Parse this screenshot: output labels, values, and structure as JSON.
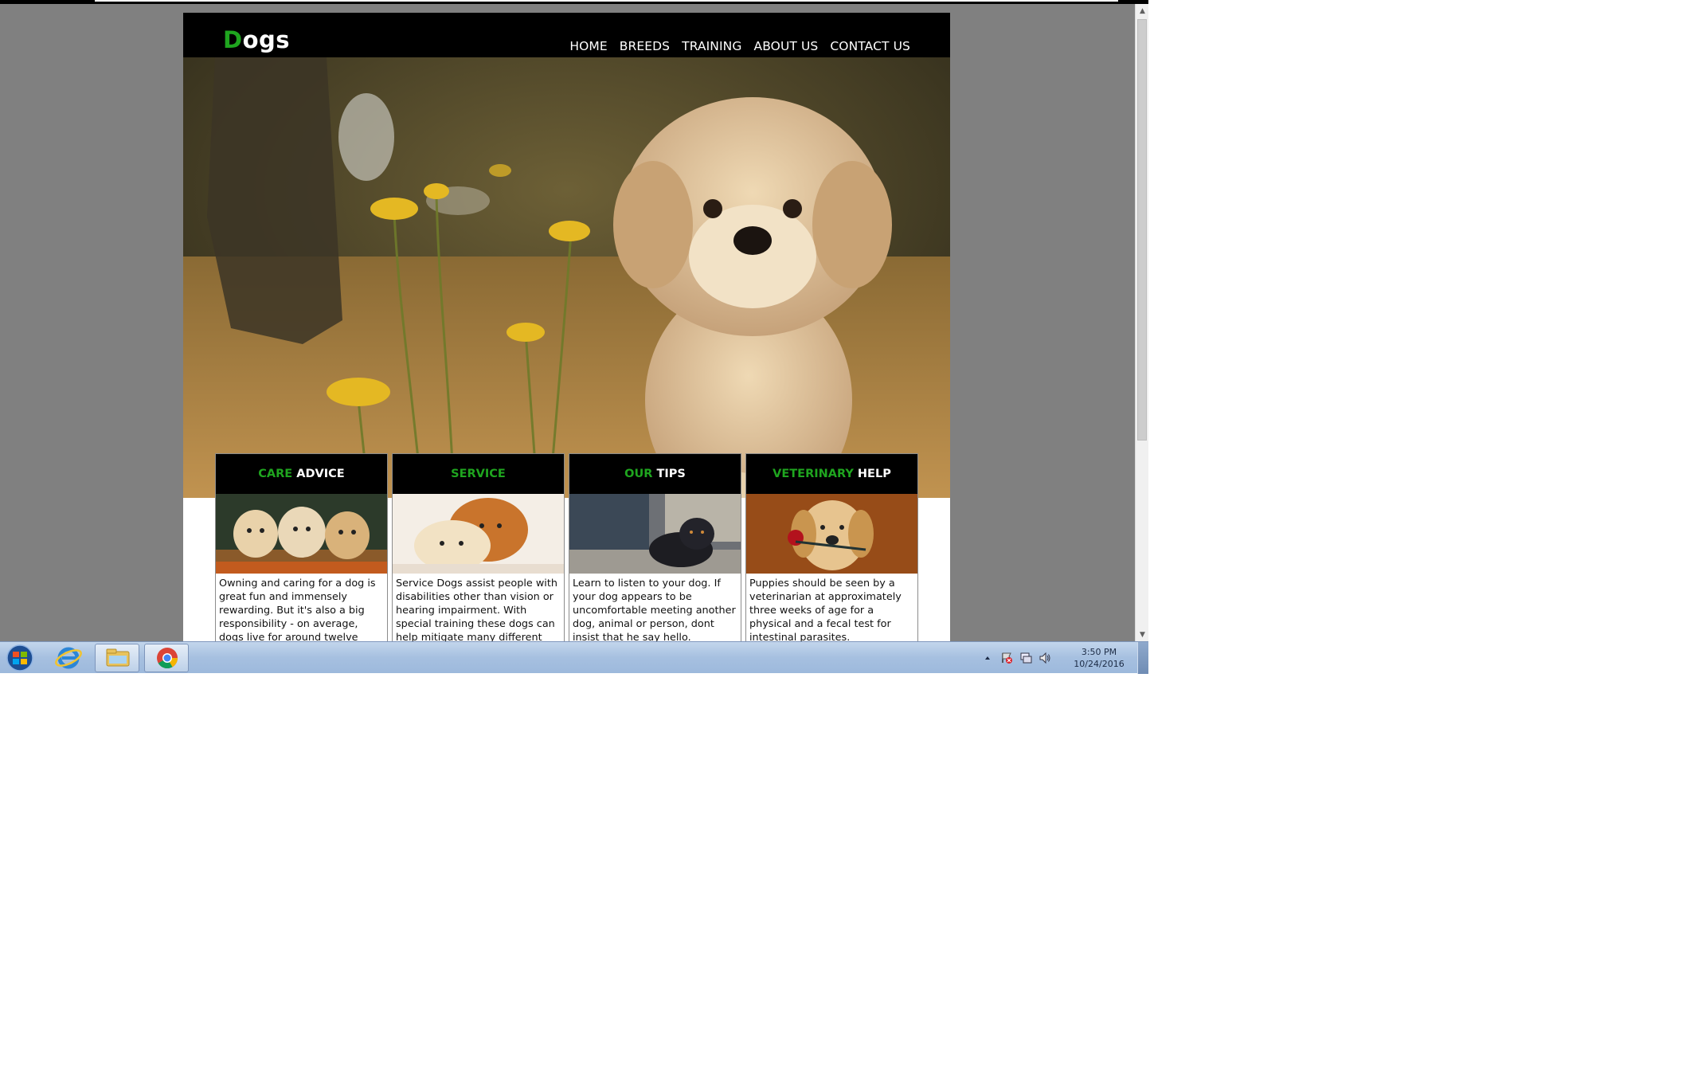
{
  "site": {
    "logo_first": "D",
    "logo_rest": "ogs",
    "nav": [
      "HOME",
      "BREEDS",
      "TRAINING",
      "ABOUT US",
      "CONTACT US"
    ]
  },
  "cards": [
    {
      "title_green": "CARE",
      "title_white": "ADVICE",
      "text": "Owning and caring for a dog is great fun and immensely rewarding. But it's also a big responsibility - on average, dogs live for around twelve years, but"
    },
    {
      "title_green": "SERVICE",
      "title_white": "",
      "text": "Service Dogs assist people with disabilities other than vision or hearing impairment. With special training these dogs can help mitigate many different types of"
    },
    {
      "title_green": "OUR",
      "title_white": "TIPS",
      "text": "Learn to listen to your dog. If your dog appears to be uncomfortable meeting another dog, animal or person, dont insist that he say hello."
    },
    {
      "title_green": "VETERINARY",
      "title_white": "HELP",
      "text": "Puppies should be seen by a veterinarian at approximately three weeks of age for a physical and a fecal test for intestinal parasites."
    }
  ],
  "taskbar": {
    "apps": [
      "start-orb",
      "internet-explorer",
      "file-explorer",
      "chrome"
    ],
    "tray_icons": [
      "show-hidden-icons",
      "action-center-icon",
      "network-icon",
      "volume-icon"
    ],
    "time": "3:50 PM",
    "date": "10/24/2016"
  },
  "colors": {
    "accent_green": "#1fa51f",
    "header_black": "#000000",
    "page_gray": "#808080"
  }
}
